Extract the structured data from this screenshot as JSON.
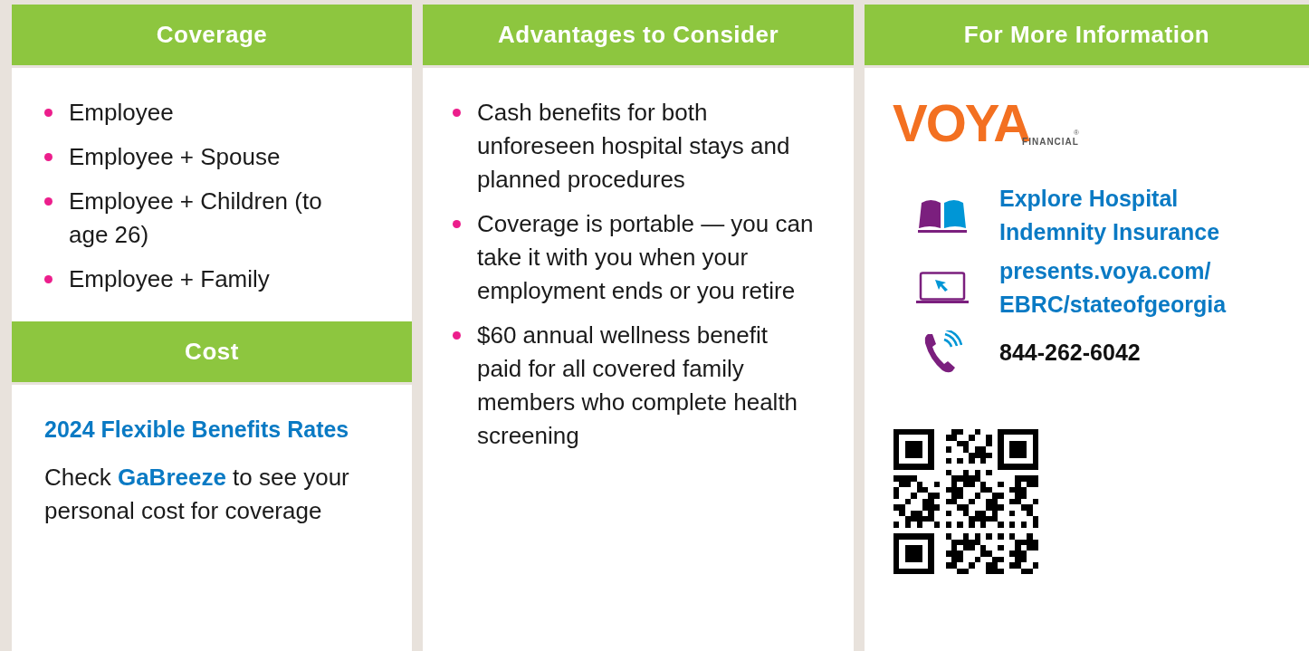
{
  "coverage": {
    "title": "Coverage",
    "items": [
      "Employee",
      "Employee + Spouse",
      "Employee + Children (to age 26)",
      "Employee + Family"
    ]
  },
  "cost": {
    "title": "Cost",
    "rates_link": "2024 Flexible Benefits Rates",
    "note": {
      "before": "Check ",
      "link": "GaBreeze",
      "after": " to see your personal cost for coverage"
    }
  },
  "advantages": {
    "title": "Advantages to Consider",
    "items": [
      "Cash benefits for both unforeseen hospital stays and planned procedures",
      "Coverage is portable — you can take it with you when your employment ends or you retire",
      "$60 annual wellness benefit paid for all covered family members who complete health screening"
    ]
  },
  "more_info": {
    "title": "For More Information",
    "logo": {
      "word": "VOYA",
      "mark": "®",
      "sub": "FINANCIAL"
    },
    "contacts": [
      {
        "kind": "book",
        "text": "Explore Hospital Indemnity Insurance",
        "link": true
      },
      {
        "kind": "laptop",
        "text": "presents.voya.com/ EBRC/stateofgeorgia",
        "link": true
      },
      {
        "kind": "phone",
        "text": "844-262-6042",
        "link": false
      }
    ]
  }
}
